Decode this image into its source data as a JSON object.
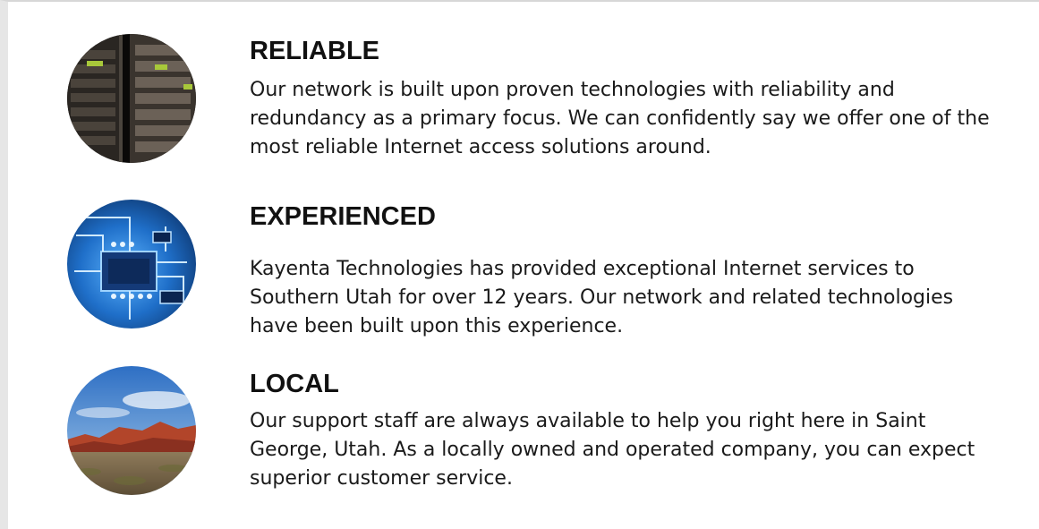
{
  "features": [
    {
      "icon": "server-rack-image",
      "title": "RELIABLE",
      "description": "Our network is built upon proven technologies with reliability and redundancy as a primary focus. We can confidently say we offer one of the most reliable Internet access solutions around."
    },
    {
      "icon": "circuit-board-image",
      "title": "EXPERIENCED",
      "description": "Kayenta Technologies has provided exceptional Internet services to Southern Utah for over 12 years. Our network and related technologies have been built upon this experience."
    },
    {
      "icon": "desert-landscape-image",
      "title": "LOCAL",
      "description": "Our support staff are always available to help you right here in Saint George, Utah. As a locally owned and operated company, you can expect superior customer service."
    }
  ],
  "colors": {
    "background": "#ffffff",
    "text": "#111111",
    "frame_border": "#e6e6e6"
  }
}
